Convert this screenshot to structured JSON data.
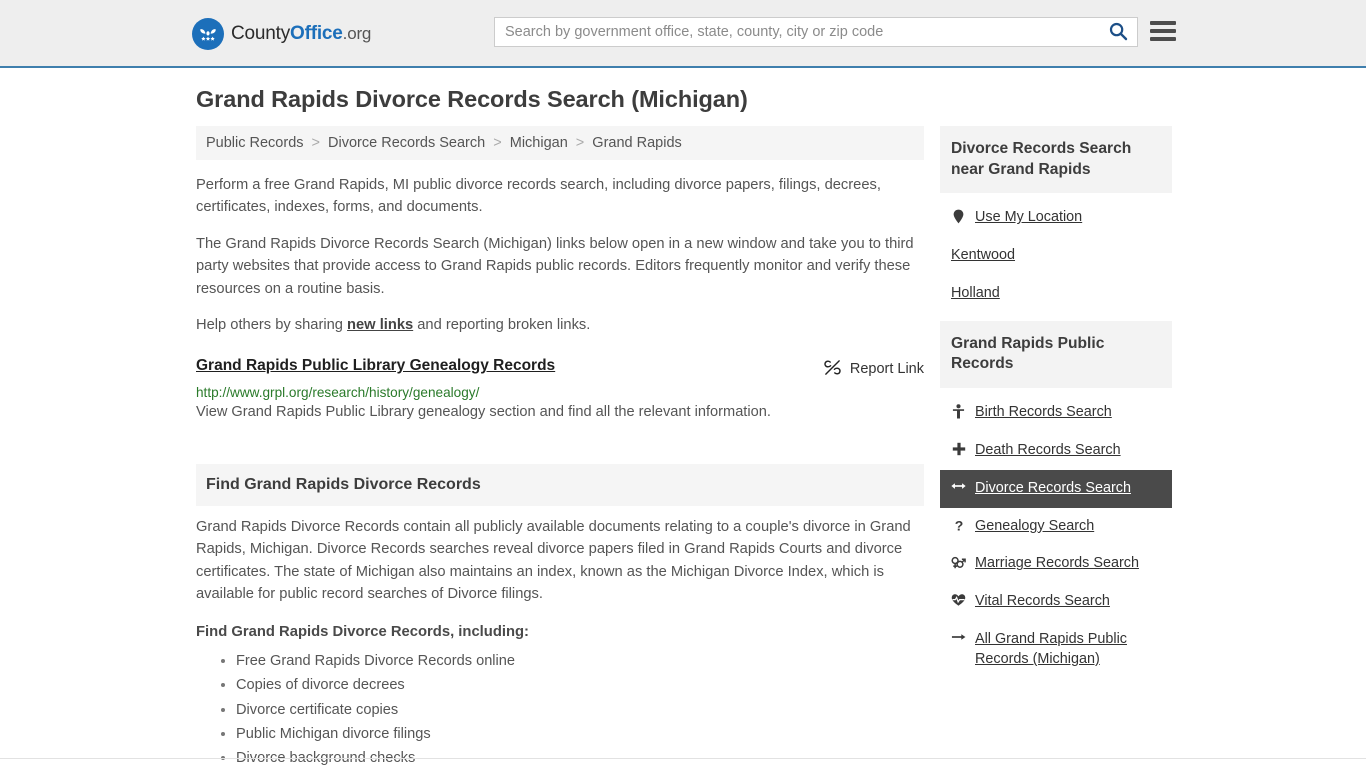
{
  "header": {
    "logo": {
      "part1": "County",
      "part2": "Office",
      "tld": ".org",
      "icon": "eagle-seal-logo"
    },
    "search": {
      "placeholder": "Search by government office, state, county, city or zip code",
      "value": "",
      "button_icon": "search-icon"
    },
    "menu_icon": "hamburger-menu-icon",
    "accent_color": "#3f7fad"
  },
  "main": {
    "page_title": "Grand Rapids Divorce Records Search (Michigan)",
    "breadcrumb": [
      {
        "label": "Public Records"
      },
      {
        "label": "Divorce Records Search"
      },
      {
        "label": "Michigan"
      },
      {
        "label": "Grand Rapids"
      }
    ],
    "breadcrumb_separator": ">",
    "paragraphs": {
      "p1": "Perform a free Grand Rapids, MI public divorce records search, including divorce papers, filings, decrees, certificates, indexes, forms, and documents.",
      "p2": "The Grand Rapids Divorce Records Search (Michigan) links below open in a new window and take you to third party websites that provide access to Grand Rapids public records. Editors frequently monitor and verify these resources on a routine basis.",
      "p3_before": "Help others by sharing ",
      "p3_link": "new links",
      "p3_after": " and reporting broken links."
    },
    "result": {
      "title": "Grand Rapids Public Library Genealogy Records",
      "url": "http://www.grpl.org/research/history/genealogy/",
      "description": "View Grand Rapids Public Library genealogy section and find all the relevant information.",
      "report_label": "Report Link",
      "report_icon": "broken-link-icon",
      "url_color": "#2a7a2a"
    },
    "section": {
      "heading": "Find Grand Rapids Divorce Records",
      "body": "Grand Rapids Divorce Records contain all publicly available documents relating to a couple's divorce in Grand Rapids, Michigan. Divorce Records searches reveal divorce papers filed in Grand Rapids Courts and divorce certificates. The state of Michigan also maintains an index, known as the Michigan Divorce Index, which is available for public record searches of Divorce filings.",
      "list_title": "Find Grand Rapids Divorce Records, including:",
      "list": [
        "Free Grand Rapids Divorce Records online",
        "Copies of divorce decrees",
        "Divorce certificate copies",
        "Public Michigan divorce filings",
        "Divorce background checks"
      ]
    }
  },
  "sidebar": {
    "nearby_panel": {
      "title": "Divorce Records Search near Grand Rapids",
      "links": [
        {
          "label": "Use My Location",
          "icon": "map-pin-icon",
          "active": false
        },
        {
          "label": "Kentwood",
          "icon": "none",
          "active": false
        },
        {
          "label": "Holland",
          "icon": "none",
          "active": false
        }
      ]
    },
    "records_panel": {
      "title": "Grand Rapids Public Records",
      "links": [
        {
          "label": "Birth Records Search",
          "icon": "baby-icon",
          "active": false
        },
        {
          "label": "Death Records Search",
          "icon": "cross-icon",
          "active": false
        },
        {
          "label": "Divorce Records Search",
          "icon": "arrows-left-right-icon",
          "active": true
        },
        {
          "label": "Genealogy Search",
          "icon": "question-mark-icon",
          "active": false
        },
        {
          "label": "Marriage Records Search",
          "icon": "venus-mars-icon",
          "active": false
        },
        {
          "label": "Vital Records Search",
          "icon": "heartbeat-icon",
          "active": false
        },
        {
          "label": "All Grand Rapids Public Records (Michigan)",
          "icon": "arrow-right-icon",
          "active": false
        }
      ],
      "active_bg": "#4a4a4a"
    }
  }
}
